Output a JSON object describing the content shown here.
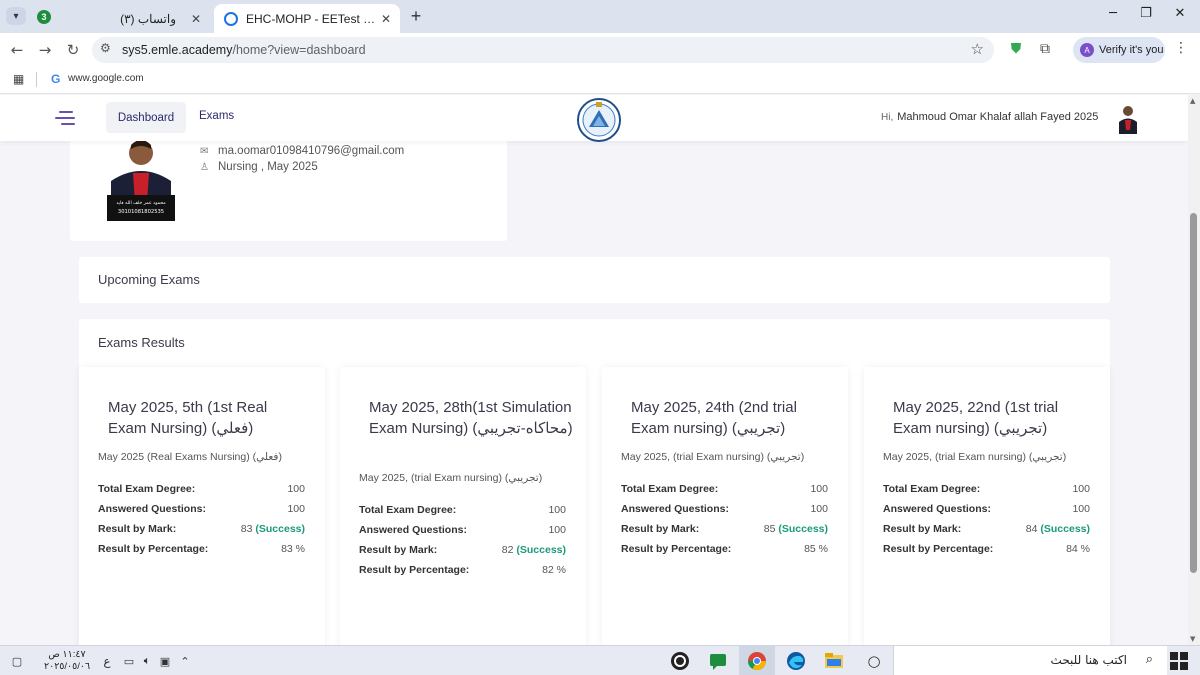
{
  "browser": {
    "tab_group_count": "3",
    "tabs": [
      {
        "title": "(٣) واتساب",
        "active": false
      },
      {
        "title": "EHC-MOHP - EETest | Dashboard",
        "active": true
      }
    ],
    "url_host": "sys5.emle.academy",
    "url_path": "/home?view=dashboard",
    "verify_label": "Verify it's you",
    "verify_avatar": "A",
    "bookmark_link": "www.google.com",
    "bookmark_letter": "G"
  },
  "header": {
    "nav": [
      {
        "label": "Dashboard",
        "active": true
      },
      {
        "label": "Exams",
        "active": false
      }
    ],
    "greeting_prefix": "Hi,",
    "user_name": "Mahmoud Omar Khalaf allah Fayed 2025"
  },
  "profile": {
    "email": "ma.oomar01098410796@gmail.com",
    "program": "Nursing , May 2025",
    "photo_caption_name": "محمود عمر خلف الله فايد",
    "photo_caption_id": "30101081802535"
  },
  "upcoming": {
    "title": "Upcoming Exams"
  },
  "results": {
    "title": "Exams Results",
    "labels": {
      "degree": "Total Exam Degree:",
      "answered": "Answered Questions:",
      "mark": "Result by Mark:",
      "percentage": "Result by Percentage:"
    },
    "success_label": "(Success)",
    "exams": [
      {
        "title": "May 2025, 5th (1st Real Exam Nursing) (فعلي)",
        "subtitle": "May 2025 (Real Exams Nursing) (فعلي)",
        "degree": "100",
        "answered": "100",
        "mark": "83",
        "percentage": "83 %"
      },
      {
        "title": "May 2025, 28th(1st Simulation Exam Nursing) (محاكاه-تجريبي)",
        "subtitle": "May 2025, (trial Exam nursing) (تجريبي)",
        "degree": "100",
        "answered": "100",
        "mark": "82",
        "percentage": "82 %"
      },
      {
        "title": "May 2025, 24th (2nd trial Exam nursing) (تجريبي)",
        "subtitle": "May 2025, (trial Exam nursing) (تجريبي)",
        "degree": "100",
        "answered": "100",
        "mark": "85",
        "percentage": "85 %"
      },
      {
        "title": "May 2025, 22nd (1st trial Exam nursing) (تجريبي)",
        "subtitle": "May 2025, (trial Exam nursing) (تجريبي)",
        "degree": "100",
        "answered": "100",
        "mark": "84",
        "percentage": "84 %"
      }
    ]
  },
  "taskbar": {
    "time": "١١:٤٧ ص",
    "date": "٢٠٢٥/٠٥/٠٦",
    "lang": "ع",
    "search_placeholder": "اكتب هنا للبحث"
  },
  "colors": {
    "accent": "#6b4fa8",
    "nav_text": "#2b2b6a",
    "success": "#1b9a7a",
    "page_bg": "#f4f4f9"
  }
}
